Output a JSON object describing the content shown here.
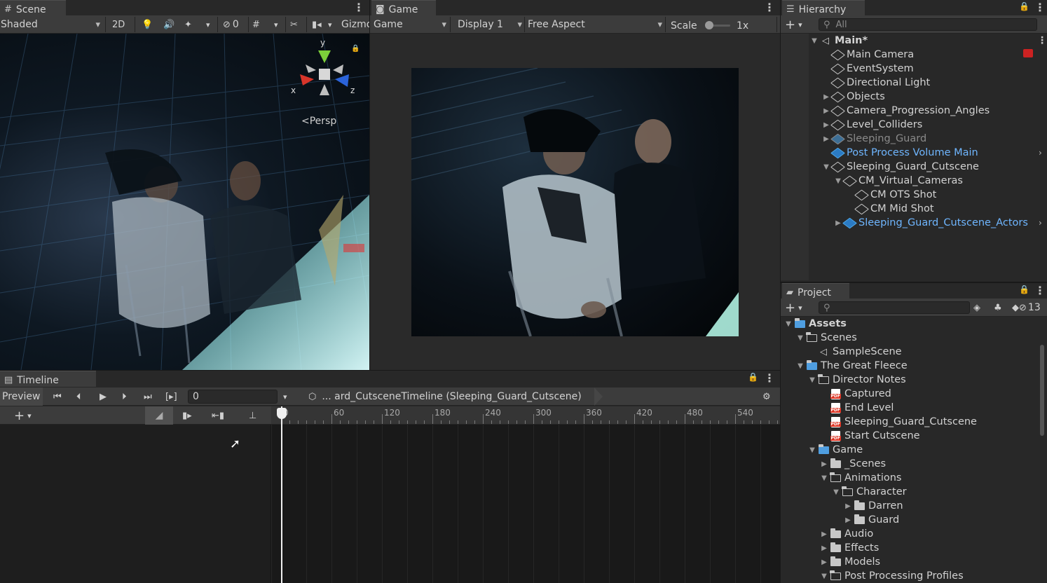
{
  "scene": {
    "tab_label": "Scene",
    "shading_mode": "Shaded",
    "mode_2d": "2D",
    "hidden_count": "0",
    "gizmos_label": "Gizmos",
    "persp_label": "Persp",
    "axis_x": "x",
    "axis_y": "y",
    "axis_z": "z"
  },
  "game": {
    "tab_label": "Game",
    "mode": "Game",
    "display": "Display 1",
    "aspect": "Free Aspect",
    "scale_label": "Scale",
    "scale_value": "1x",
    "scale_level": 0.0
  },
  "hierarchy": {
    "tab_label": "Hierarchy",
    "search_placeholder": "All",
    "items": [
      {
        "label": "Main*",
        "depth": 0,
        "arrow": "down",
        "icon": "unity-scene",
        "style": "bold"
      },
      {
        "label": "Main Camera",
        "depth": 1,
        "arrow": "",
        "icon": "cube",
        "style": "normal"
      },
      {
        "label": "EventSystem",
        "depth": 1,
        "arrow": "",
        "icon": "cube",
        "style": "normal"
      },
      {
        "label": "Directional Light",
        "depth": 1,
        "arrow": "",
        "icon": "cube",
        "style": "normal"
      },
      {
        "label": "Objects",
        "depth": 1,
        "arrow": "right",
        "icon": "cube",
        "style": "normal"
      },
      {
        "label": "Camera_Progression_Angles",
        "depth": 1,
        "arrow": "right",
        "icon": "cube",
        "style": "normal"
      },
      {
        "label": "Level_Colliders",
        "depth": 1,
        "arrow": "right",
        "icon": "cube",
        "style": "normal"
      },
      {
        "label": "Sleeping_Guard",
        "depth": 1,
        "arrow": "right",
        "icon": "cube-gray-blue",
        "style": "dim"
      },
      {
        "label": "Post Process Volume Main",
        "depth": 1,
        "arrow": "",
        "icon": "cube-blue",
        "style": "blue"
      },
      {
        "label": "Sleeping_Guard_Cutscene",
        "depth": 1,
        "arrow": "down",
        "icon": "cube",
        "style": "normal"
      },
      {
        "label": "CM_Virtual_Cameras",
        "depth": 2,
        "arrow": "down",
        "icon": "cube",
        "style": "normal"
      },
      {
        "label": "CM OTS Shot",
        "depth": 3,
        "arrow": "",
        "icon": "cube",
        "style": "normal"
      },
      {
        "label": "CM Mid Shot",
        "depth": 3,
        "arrow": "",
        "icon": "cube",
        "style": "normal"
      },
      {
        "label": "Sleeping_Guard_Cutscene_Actors",
        "depth": 2,
        "arrow": "right",
        "icon": "cube-blue",
        "style": "blue"
      }
    ]
  },
  "project": {
    "tab_label": "Project",
    "hidden_count": "13",
    "items": [
      {
        "label": "Assets",
        "depth": 0,
        "arrow": "down",
        "icon": "folder-assets",
        "style": "bold"
      },
      {
        "label": "Scenes",
        "depth": 1,
        "arrow": "down",
        "icon": "folder-open",
        "style": "normal"
      },
      {
        "label": "SampleScene",
        "depth": 2,
        "arrow": "",
        "icon": "unity-scene",
        "style": "normal"
      },
      {
        "label": "The Great Fleece",
        "depth": 1,
        "arrow": "down",
        "icon": "folder-assets",
        "style": "normal"
      },
      {
        "label": "Director Notes",
        "depth": 2,
        "arrow": "down",
        "icon": "folder-open",
        "style": "normal"
      },
      {
        "label": "Captured",
        "depth": 3,
        "arrow": "",
        "icon": "pdf",
        "style": "normal"
      },
      {
        "label": "End Level",
        "depth": 3,
        "arrow": "",
        "icon": "pdf",
        "style": "normal"
      },
      {
        "label": "Sleeping_Guard_Cutscene",
        "depth": 3,
        "arrow": "",
        "icon": "pdf",
        "style": "normal"
      },
      {
        "label": "Start Cutscene",
        "depth": 3,
        "arrow": "",
        "icon": "pdf",
        "style": "normal"
      },
      {
        "label": "Game",
        "depth": 2,
        "arrow": "down",
        "icon": "folder-assets",
        "style": "normal"
      },
      {
        "label": "_Scenes",
        "depth": 3,
        "arrow": "right",
        "icon": "folder",
        "style": "normal"
      },
      {
        "label": "Animations",
        "depth": 3,
        "arrow": "down",
        "icon": "folder-open",
        "style": "normal"
      },
      {
        "label": "Character",
        "depth": 4,
        "arrow": "down",
        "icon": "folder-open",
        "style": "normal"
      },
      {
        "label": "Darren",
        "depth": 5,
        "arrow": "right",
        "icon": "folder",
        "style": "normal"
      },
      {
        "label": "Guard",
        "depth": 5,
        "arrow": "right",
        "icon": "folder",
        "style": "normal"
      },
      {
        "label": "Audio",
        "depth": 3,
        "arrow": "right",
        "icon": "folder",
        "style": "normal"
      },
      {
        "label": "Effects",
        "depth": 3,
        "arrow": "right",
        "icon": "folder",
        "style": "normal"
      },
      {
        "label": "Models",
        "depth": 3,
        "arrow": "right",
        "icon": "folder",
        "style": "normal"
      },
      {
        "label": "Post Processing Profiles",
        "depth": 3,
        "arrow": "down",
        "icon": "folder-open",
        "style": "normal"
      }
    ]
  },
  "timeline": {
    "tab_label": "Timeline",
    "preview_label": "Preview",
    "frame_value": "0",
    "asset_path": "... ard_CutsceneTimeline (Sleeping_Guard_Cutscene)",
    "ruler_labels": [
      "0",
      "60",
      "120",
      "180",
      "240",
      "300",
      "360",
      "420",
      "480",
      "540"
    ],
    "playhead_frame": 0
  }
}
